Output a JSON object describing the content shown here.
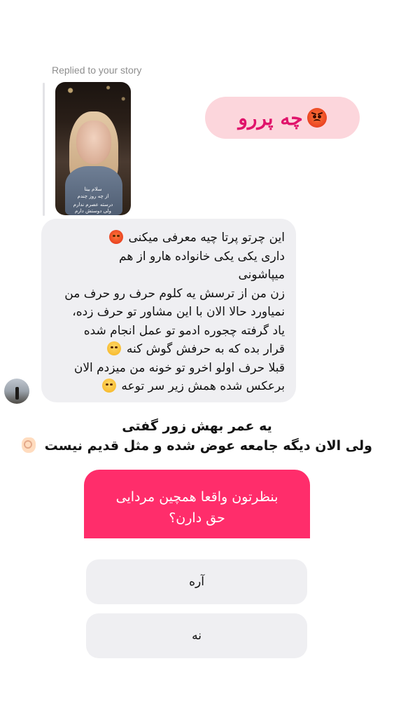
{
  "reply_header": "Replied to your story",
  "story": {
    "caption_line1": "سلام بیتا",
    "caption_line2": "از چه روز چندم",
    "caption_line3": "درسته عصرم ندارم",
    "caption_line4": "ولی دوستش دارم"
  },
  "sticker": {
    "text": "چه پررو",
    "emoji": "angry-face-icon"
  },
  "message": {
    "lines": [
      "این چرتو پرتا چیه معرفی میکنی",
      "داری یکی یکی خانواده هارو از هم",
      "میپاشونی",
      "زن من از ترسش یه کلوم حرف رو حرف من",
      "نمیاورد حالا الان با این مشاور تو حرف زده،",
      "یاد گرفته چجوره ادمو تو عمل انجام شده",
      "قرار بده که به حرفش گوش کنه",
      "قبلا حرف اولو اخرو تو خونه من میزدم الان",
      "برعکس شده همش زیر سر توعه"
    ]
  },
  "overlay": {
    "line1": "یه عمر بهش زور گفتی",
    "line2": "ولی الان دیگه جامعه عوض شده و مثل قدیم نیست"
  },
  "poll": {
    "question_line1": "بنظرتون واقعا همچین مردایی",
    "question_line2": "حق دارن؟",
    "option_yes": "آره",
    "option_no": "نه"
  }
}
